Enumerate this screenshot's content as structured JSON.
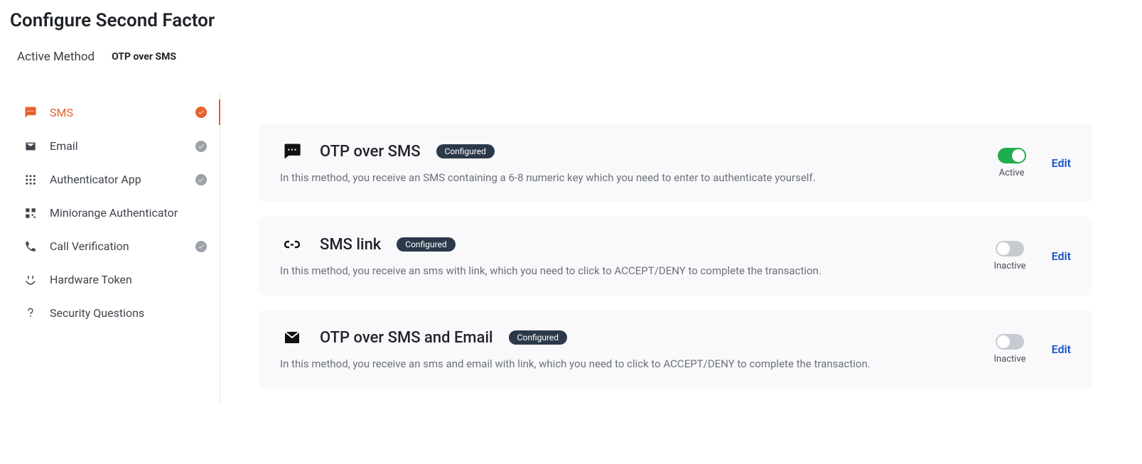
{
  "page_title": "Configure Second Factor",
  "active_method_label": "Active Method",
  "active_method_value": "OTP over SMS",
  "sidebar": {
    "items": [
      {
        "label": "SMS"
      },
      {
        "label": "Email"
      },
      {
        "label": "Authenticator App"
      },
      {
        "label": "Miniorange Authenticator"
      },
      {
        "label": "Call Verification"
      },
      {
        "label": "Hardware Token"
      },
      {
        "label": "Security Questions"
      }
    ]
  },
  "methods": [
    {
      "title": "OTP over SMS",
      "badge": "Configured",
      "desc": "In this method, you receive an SMS containing a 6-8 numeric key which you need to enter to authenticate yourself.",
      "status": "Active",
      "edit": "Edit"
    },
    {
      "title": "SMS link",
      "badge": "Configured",
      "desc": "In this method, you receive an sms with link, which you need to click to ACCEPT/DENY to complete the transaction.",
      "status": "Inactive",
      "edit": "Edit"
    },
    {
      "title": "OTP over SMS and Email",
      "badge": "Configured",
      "desc": "In this method, you receive an sms and email with link, which you need to click to ACCEPT/DENY to complete the transaction.",
      "status": "Inactive",
      "edit": "Edit"
    }
  ]
}
